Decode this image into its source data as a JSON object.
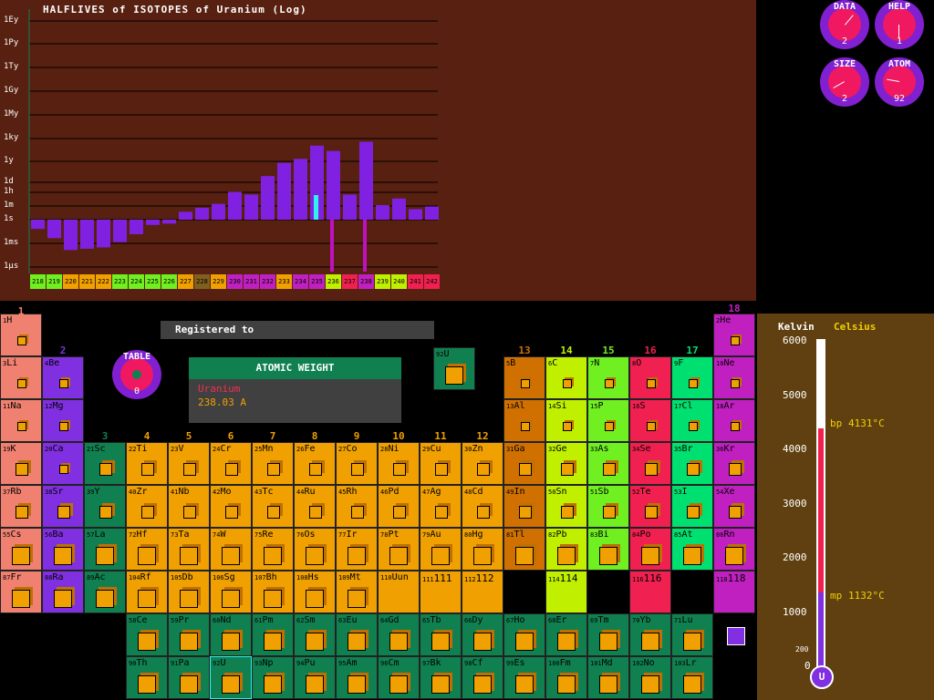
{
  "chart": {
    "title": "HALFLIVES of ISOTOPES of Uranium (Log)",
    "ytick_labels": [
      "1Ey",
      "1Py",
      "1Ty",
      "1Gy",
      "1My",
      "1ky",
      "1y",
      "1d",
      "1h",
      "1m",
      "1s",
      "1ms",
      "1μs"
    ]
  },
  "chart_data": {
    "type": "bar",
    "categories": [
      "218",
      "219",
      "220",
      "221",
      "222",
      "223",
      "224",
      "225",
      "226",
      "227",
      "228",
      "229",
      "230",
      "231",
      "232",
      "233",
      "234",
      "235",
      "236",
      "237",
      "238",
      "239",
      "240",
      "241",
      "242"
    ],
    "values": [
      -0.7,
      -1.4,
      -2.3,
      -2.2,
      -2.1,
      -1.7,
      -1.1,
      -0.4,
      -0.3,
      0.6,
      0.9,
      1.2,
      2.1,
      1.9,
      3.3,
      4.3,
      4.6,
      5.6,
      5.2,
      1.9,
      5.9,
      1.1,
      1.6,
      0.8,
      1.0
    ],
    "ylabel": "",
    "xlabel": "",
    "ylim": [
      -3,
      14
    ]
  },
  "dials": [
    {
      "label": "DATA",
      "value": "2"
    },
    {
      "label": "HELP",
      "value": "1"
    },
    {
      "label": "SIZE",
      "value": "2"
    },
    {
      "label": "ATOM",
      "value": "92"
    }
  ],
  "registered": "Registered to",
  "table_dial": {
    "label": "TABLE",
    "value": "0"
  },
  "atomic_weight": {
    "heading": "ATOMIC WEIGHT",
    "name": "Uranium",
    "value": "238.03 A"
  },
  "selected": {
    "num": "92",
    "sym": "U"
  },
  "groups": [
    "1",
    "2",
    "3",
    "4",
    "5",
    "6",
    "7",
    "8",
    "9",
    "10",
    "11",
    "12",
    "13",
    "14",
    "15",
    "16",
    "17",
    "18"
  ],
  "therm": {
    "kelvin": "Kelvin",
    "celsius": "Celsius",
    "ticks": [
      "6000",
      "5000",
      "4000",
      "3000",
      "2000",
      "1000",
      "0"
    ],
    "small": "200",
    "bp": "bp",
    "bp_val": "4131°C",
    "mp": "mp",
    "mp_val": "1132°C",
    "bulb": "U"
  },
  "colors": {
    "alkali": "#f08070",
    "alkaline": "#8030e0",
    "transition": "#f0a000",
    "lan": "#108050",
    "post": "#d07000",
    "metalloid": "#c0f000",
    "nonmetal": "#70f020",
    "halogen": "#00e070",
    "noble": "#c020c0",
    "chalc": "#f02050"
  }
}
